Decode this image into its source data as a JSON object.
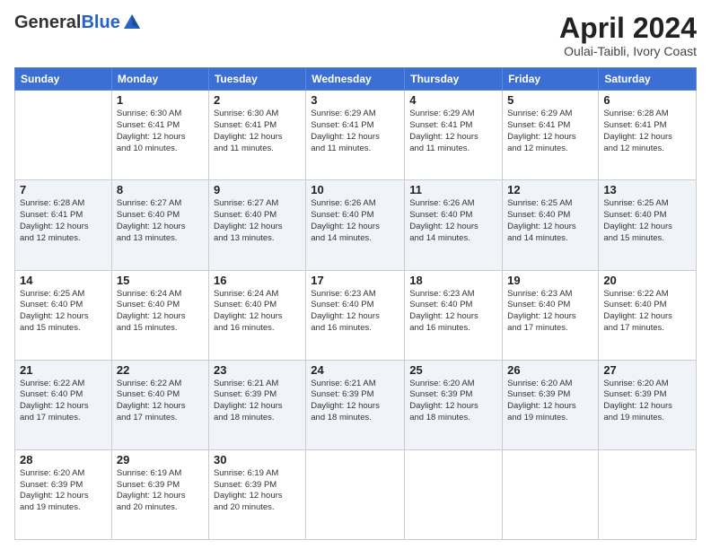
{
  "logo": {
    "general": "General",
    "blue": "Blue"
  },
  "header": {
    "title": "April 2024",
    "subtitle": "Oulai-Taibli, Ivory Coast"
  },
  "weekdays": [
    "Sunday",
    "Monday",
    "Tuesday",
    "Wednesday",
    "Thursday",
    "Friday",
    "Saturday"
  ],
  "weeks": [
    [
      {
        "day": "",
        "info": ""
      },
      {
        "day": "1",
        "info": "Sunrise: 6:30 AM\nSunset: 6:41 PM\nDaylight: 12 hours\nand 10 minutes."
      },
      {
        "day": "2",
        "info": "Sunrise: 6:30 AM\nSunset: 6:41 PM\nDaylight: 12 hours\nand 11 minutes."
      },
      {
        "day": "3",
        "info": "Sunrise: 6:29 AM\nSunset: 6:41 PM\nDaylight: 12 hours\nand 11 minutes."
      },
      {
        "day": "4",
        "info": "Sunrise: 6:29 AM\nSunset: 6:41 PM\nDaylight: 12 hours\nand 11 minutes."
      },
      {
        "day": "5",
        "info": "Sunrise: 6:29 AM\nSunset: 6:41 PM\nDaylight: 12 hours\nand 12 minutes."
      },
      {
        "day": "6",
        "info": "Sunrise: 6:28 AM\nSunset: 6:41 PM\nDaylight: 12 hours\nand 12 minutes."
      }
    ],
    [
      {
        "day": "7",
        "info": "Sunrise: 6:28 AM\nSunset: 6:41 PM\nDaylight: 12 hours\nand 12 minutes."
      },
      {
        "day": "8",
        "info": "Sunrise: 6:27 AM\nSunset: 6:40 PM\nDaylight: 12 hours\nand 13 minutes."
      },
      {
        "day": "9",
        "info": "Sunrise: 6:27 AM\nSunset: 6:40 PM\nDaylight: 12 hours\nand 13 minutes."
      },
      {
        "day": "10",
        "info": "Sunrise: 6:26 AM\nSunset: 6:40 PM\nDaylight: 12 hours\nand 14 minutes."
      },
      {
        "day": "11",
        "info": "Sunrise: 6:26 AM\nSunset: 6:40 PM\nDaylight: 12 hours\nand 14 minutes."
      },
      {
        "day": "12",
        "info": "Sunrise: 6:25 AM\nSunset: 6:40 PM\nDaylight: 12 hours\nand 14 minutes."
      },
      {
        "day": "13",
        "info": "Sunrise: 6:25 AM\nSunset: 6:40 PM\nDaylight: 12 hours\nand 15 minutes."
      }
    ],
    [
      {
        "day": "14",
        "info": "Sunrise: 6:25 AM\nSunset: 6:40 PM\nDaylight: 12 hours\nand 15 minutes."
      },
      {
        "day": "15",
        "info": "Sunrise: 6:24 AM\nSunset: 6:40 PM\nDaylight: 12 hours\nand 15 minutes."
      },
      {
        "day": "16",
        "info": "Sunrise: 6:24 AM\nSunset: 6:40 PM\nDaylight: 12 hours\nand 16 minutes."
      },
      {
        "day": "17",
        "info": "Sunrise: 6:23 AM\nSunset: 6:40 PM\nDaylight: 12 hours\nand 16 minutes."
      },
      {
        "day": "18",
        "info": "Sunrise: 6:23 AM\nSunset: 6:40 PM\nDaylight: 12 hours\nand 16 minutes."
      },
      {
        "day": "19",
        "info": "Sunrise: 6:23 AM\nSunset: 6:40 PM\nDaylight: 12 hours\nand 17 minutes."
      },
      {
        "day": "20",
        "info": "Sunrise: 6:22 AM\nSunset: 6:40 PM\nDaylight: 12 hours\nand 17 minutes."
      }
    ],
    [
      {
        "day": "21",
        "info": "Sunrise: 6:22 AM\nSunset: 6:40 PM\nDaylight: 12 hours\nand 17 minutes."
      },
      {
        "day": "22",
        "info": "Sunrise: 6:22 AM\nSunset: 6:40 PM\nDaylight: 12 hours\nand 17 minutes."
      },
      {
        "day": "23",
        "info": "Sunrise: 6:21 AM\nSunset: 6:39 PM\nDaylight: 12 hours\nand 18 minutes."
      },
      {
        "day": "24",
        "info": "Sunrise: 6:21 AM\nSunset: 6:39 PM\nDaylight: 12 hours\nand 18 minutes."
      },
      {
        "day": "25",
        "info": "Sunrise: 6:20 AM\nSunset: 6:39 PM\nDaylight: 12 hours\nand 18 minutes."
      },
      {
        "day": "26",
        "info": "Sunrise: 6:20 AM\nSunset: 6:39 PM\nDaylight: 12 hours\nand 19 minutes."
      },
      {
        "day": "27",
        "info": "Sunrise: 6:20 AM\nSunset: 6:39 PM\nDaylight: 12 hours\nand 19 minutes."
      }
    ],
    [
      {
        "day": "28",
        "info": "Sunrise: 6:20 AM\nSunset: 6:39 PM\nDaylight: 12 hours\nand 19 minutes."
      },
      {
        "day": "29",
        "info": "Sunrise: 6:19 AM\nSunset: 6:39 PM\nDaylight: 12 hours\nand 20 minutes."
      },
      {
        "day": "30",
        "info": "Sunrise: 6:19 AM\nSunset: 6:39 PM\nDaylight: 12 hours\nand 20 minutes."
      },
      {
        "day": "",
        "info": ""
      },
      {
        "day": "",
        "info": ""
      },
      {
        "day": "",
        "info": ""
      },
      {
        "day": "",
        "info": ""
      }
    ]
  ]
}
